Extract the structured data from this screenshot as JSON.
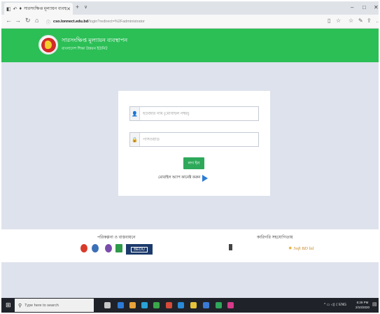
{
  "browser": {
    "tab_title": "সারসংক্ষিপ্ত মূল্যায়ন ব্যবস্থা",
    "url_domain": "cso.lonnect.edu.bd",
    "url_path": "/login?redirect=%2Fadministrator"
  },
  "header": {
    "title": "সারসংক্ষিপ্ত মূল্যায়ন ব্যবস্থাপন",
    "subtitle": "বাংলাদেশ শিক্ষা উন্নয়ন ইউনিট"
  },
  "login": {
    "username_placeholder": "ইউজার নাম (মোবাইল নম্বর)",
    "password_placeholder": "পাসওয়ার্ড",
    "submit_label": "লগ ইন",
    "connect_link_label": "মোবাইল অ্যাপ কানেক্ট করুন"
  },
  "footer": {
    "partners_heading": "পরিকল্পনা ও বাস্তবায়নে",
    "tech_heading": "কারিগরি সহযোগিতায়",
    "beou_label": "BEOU",
    "softbd_label": "Soft BD ltd"
  },
  "taskbar": {
    "search_placeholder": "Type here to search",
    "time": "6:29 PM",
    "date": "2/10/2020"
  },
  "colors": {
    "header_green": "#2bbf56",
    "button_green": "#2ea95a",
    "page_background": "#dee2ec"
  }
}
